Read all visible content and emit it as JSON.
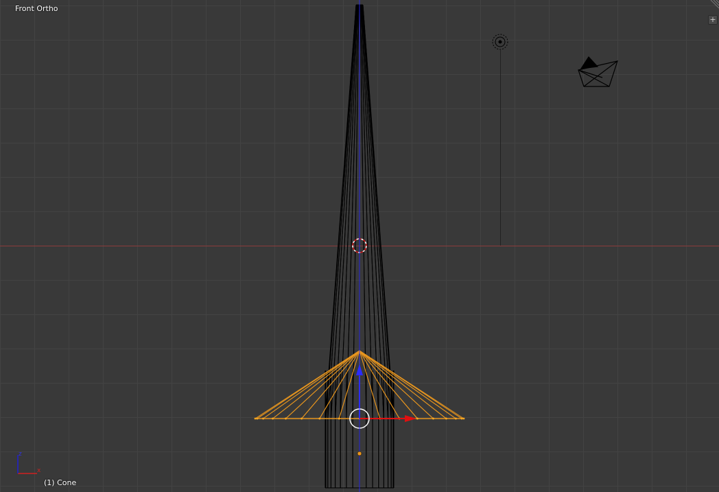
{
  "viewport": {
    "view_name": "Front Ortho",
    "active_object": "(1) Cone",
    "expand_button": "+"
  },
  "axis_gizmo": {
    "x_label": "x",
    "z_label": "z"
  },
  "colors": {
    "background": "#393939",
    "grid": "#434343",
    "x_axis": "#9b3b3b",
    "wire": "#000000",
    "selected": "#f5a623",
    "manipulator_z": "#2b2bff",
    "manipulator_x": "#e01010"
  },
  "icons": [
    "lamp-icon",
    "camera-icon",
    "3d-cursor-icon",
    "transform-manipulator-icon",
    "origin-point-icon",
    "area-split-corner-icon"
  ]
}
